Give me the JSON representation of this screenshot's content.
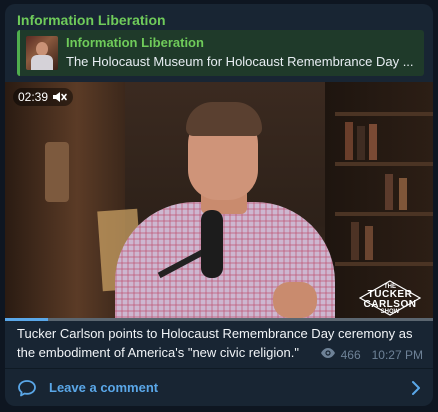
{
  "channel": {
    "name": "Information Liberation"
  },
  "reply": {
    "title": "Information Liberation",
    "text": "The Holocaust Museum for Holocaust Remembrance Day ..."
  },
  "video": {
    "duration": "02:39",
    "muted": true,
    "progress": 0.1,
    "watermark": {
      "top": "THE",
      "line1": "TUCKER",
      "line2": "CARLSON",
      "bottom": "SHOW"
    }
  },
  "caption": "Tucker Carlson points to Holocaust Remembrance Day ceremony as the embodiment of America's \"new civic religion.\"",
  "meta": {
    "views": "466",
    "time": "10:27 PM",
    "view_icon": "eye-icon"
  },
  "comments": {
    "label": "Leave a comment",
    "icon": "comment-bubble-icon",
    "arrow_icon": "chevron-right-icon"
  },
  "colors": {
    "background": "#0e1621",
    "bubble": "#182533",
    "channel_green": "#6fcb5a",
    "link_blue": "#5aa7e8"
  }
}
